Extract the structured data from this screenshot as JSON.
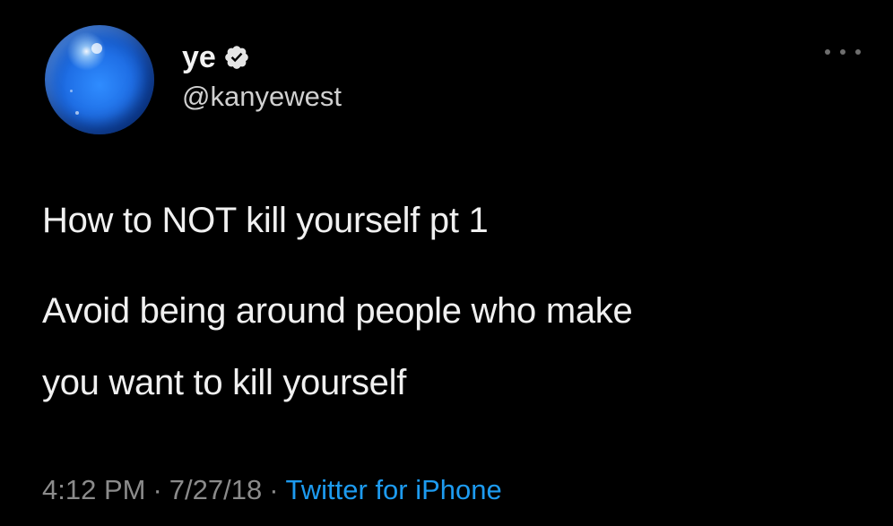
{
  "tweet": {
    "author": {
      "display_name": "ye",
      "handle": "@kanyewest",
      "verified": true,
      "avatar_icon": "blue-orb-avatar"
    },
    "more_icon": "more-horizontal-icon",
    "text_lines": [
      "How to NOT kill yourself pt 1",
      "Avoid being around people who make",
      "you want to kill yourself"
    ],
    "meta": {
      "time": "4:12 PM",
      "separator": "·",
      "date": "7/27/18",
      "source": "Twitter for iPhone"
    }
  },
  "colors": {
    "background": "#000000",
    "text": "#f0f0f0",
    "secondary": "#8b8b8b",
    "link": "#1d9bf0"
  }
}
